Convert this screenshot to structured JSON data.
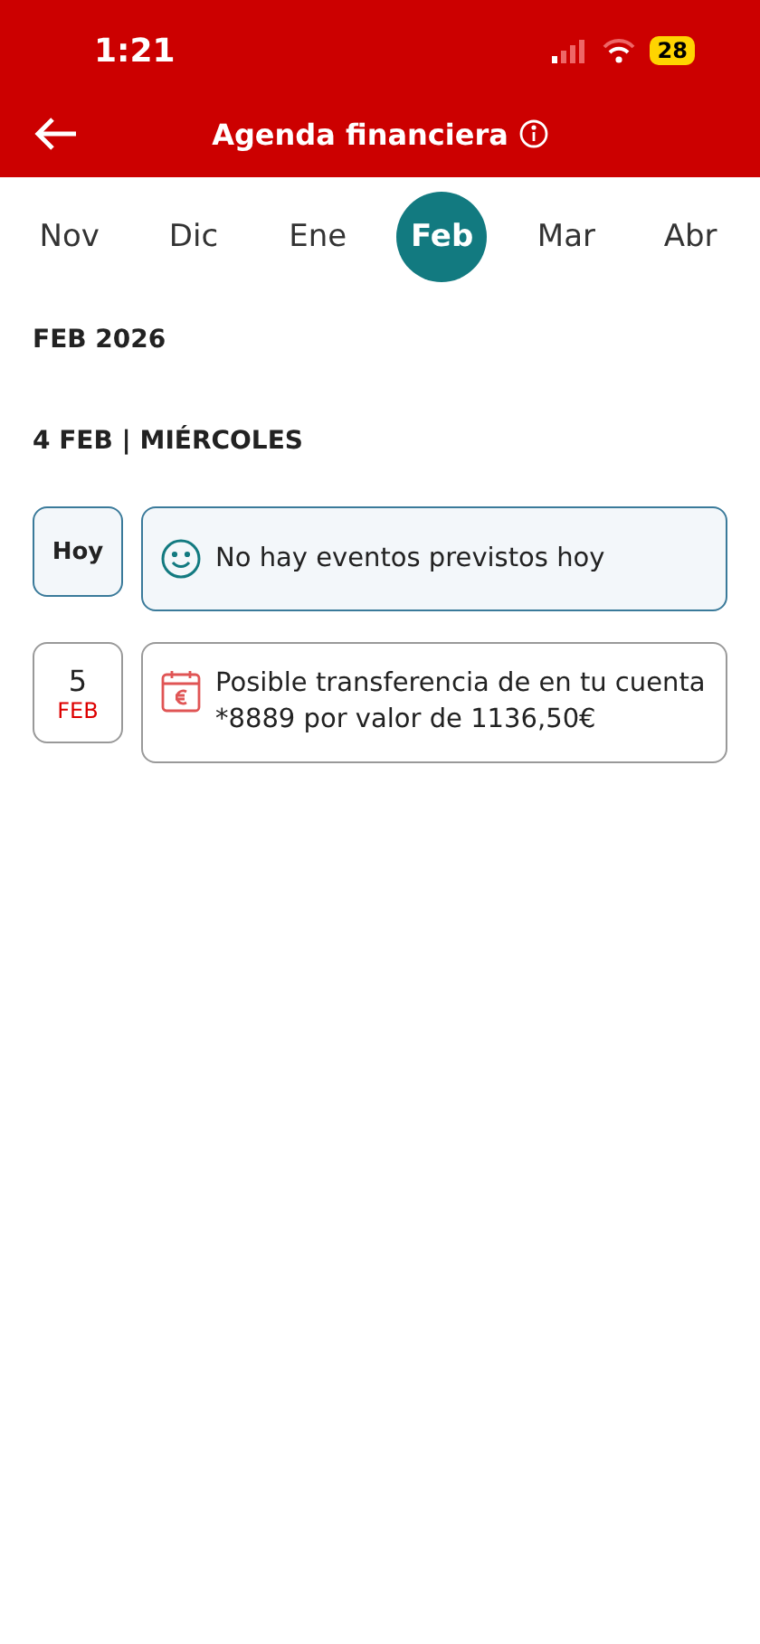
{
  "status_bar": {
    "time": "1:21",
    "battery": "28"
  },
  "header": {
    "title": "Agenda financiera"
  },
  "months": [
    {
      "label": "Nov",
      "selected": false
    },
    {
      "label": "Dic",
      "selected": false
    },
    {
      "label": "Ene",
      "selected": false
    },
    {
      "label": "Feb",
      "selected": true
    },
    {
      "label": "Mar",
      "selected": false
    },
    {
      "label": "Abr",
      "selected": false
    }
  ],
  "month_title": "FEB 2026",
  "day_title": "4 FEB | MIÉRCOLES",
  "events": [
    {
      "kind": "today",
      "day_label": "Hoy",
      "text": "No hay eventos previstos hoy"
    },
    {
      "kind": "event",
      "day": "5",
      "month": "FEB",
      "text": "Posible transferencia de  en tu cuenta *8889 por valor de 1136,50€"
    }
  ]
}
